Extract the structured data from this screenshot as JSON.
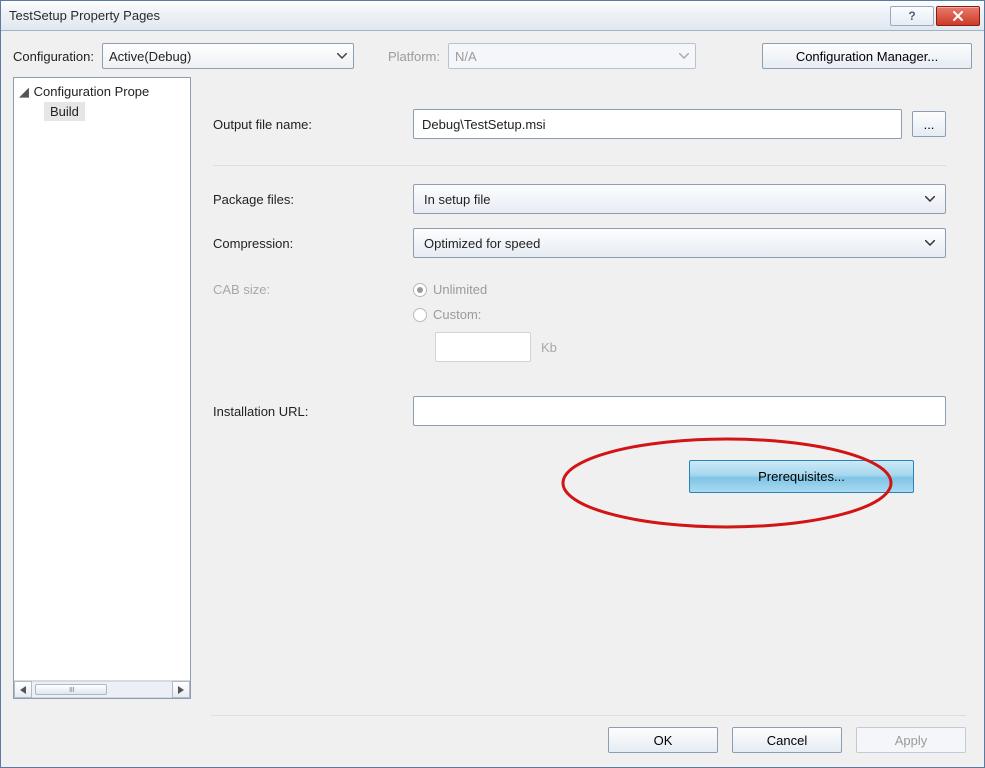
{
  "window": {
    "title": "TestSetup Property Pages"
  },
  "toolbar": {
    "configuration_label": "Configuration:",
    "configuration_value": "Active(Debug)",
    "platform_label": "Platform:",
    "platform_value": "N/A",
    "config_manager_label": "Configuration Manager..."
  },
  "tree": {
    "root": "Configuration Prope",
    "items": [
      "Build"
    ]
  },
  "form": {
    "output_label": "Output file name:",
    "output_value": "Debug\\TestSetup.msi",
    "browse_label": "...",
    "package_label": "Package files:",
    "package_value": "In setup file",
    "compression_label": "Compression:",
    "compression_value": "Optimized for speed",
    "cab_label": "CAB size:",
    "cab_unlimited": "Unlimited",
    "cab_custom": "Custom:",
    "cab_unit": "Kb",
    "install_url_label": "Installation URL:",
    "install_url_value": "",
    "prereq_label": "Prerequisites..."
  },
  "footer": {
    "ok": "OK",
    "cancel": "Cancel",
    "apply": "Apply"
  }
}
